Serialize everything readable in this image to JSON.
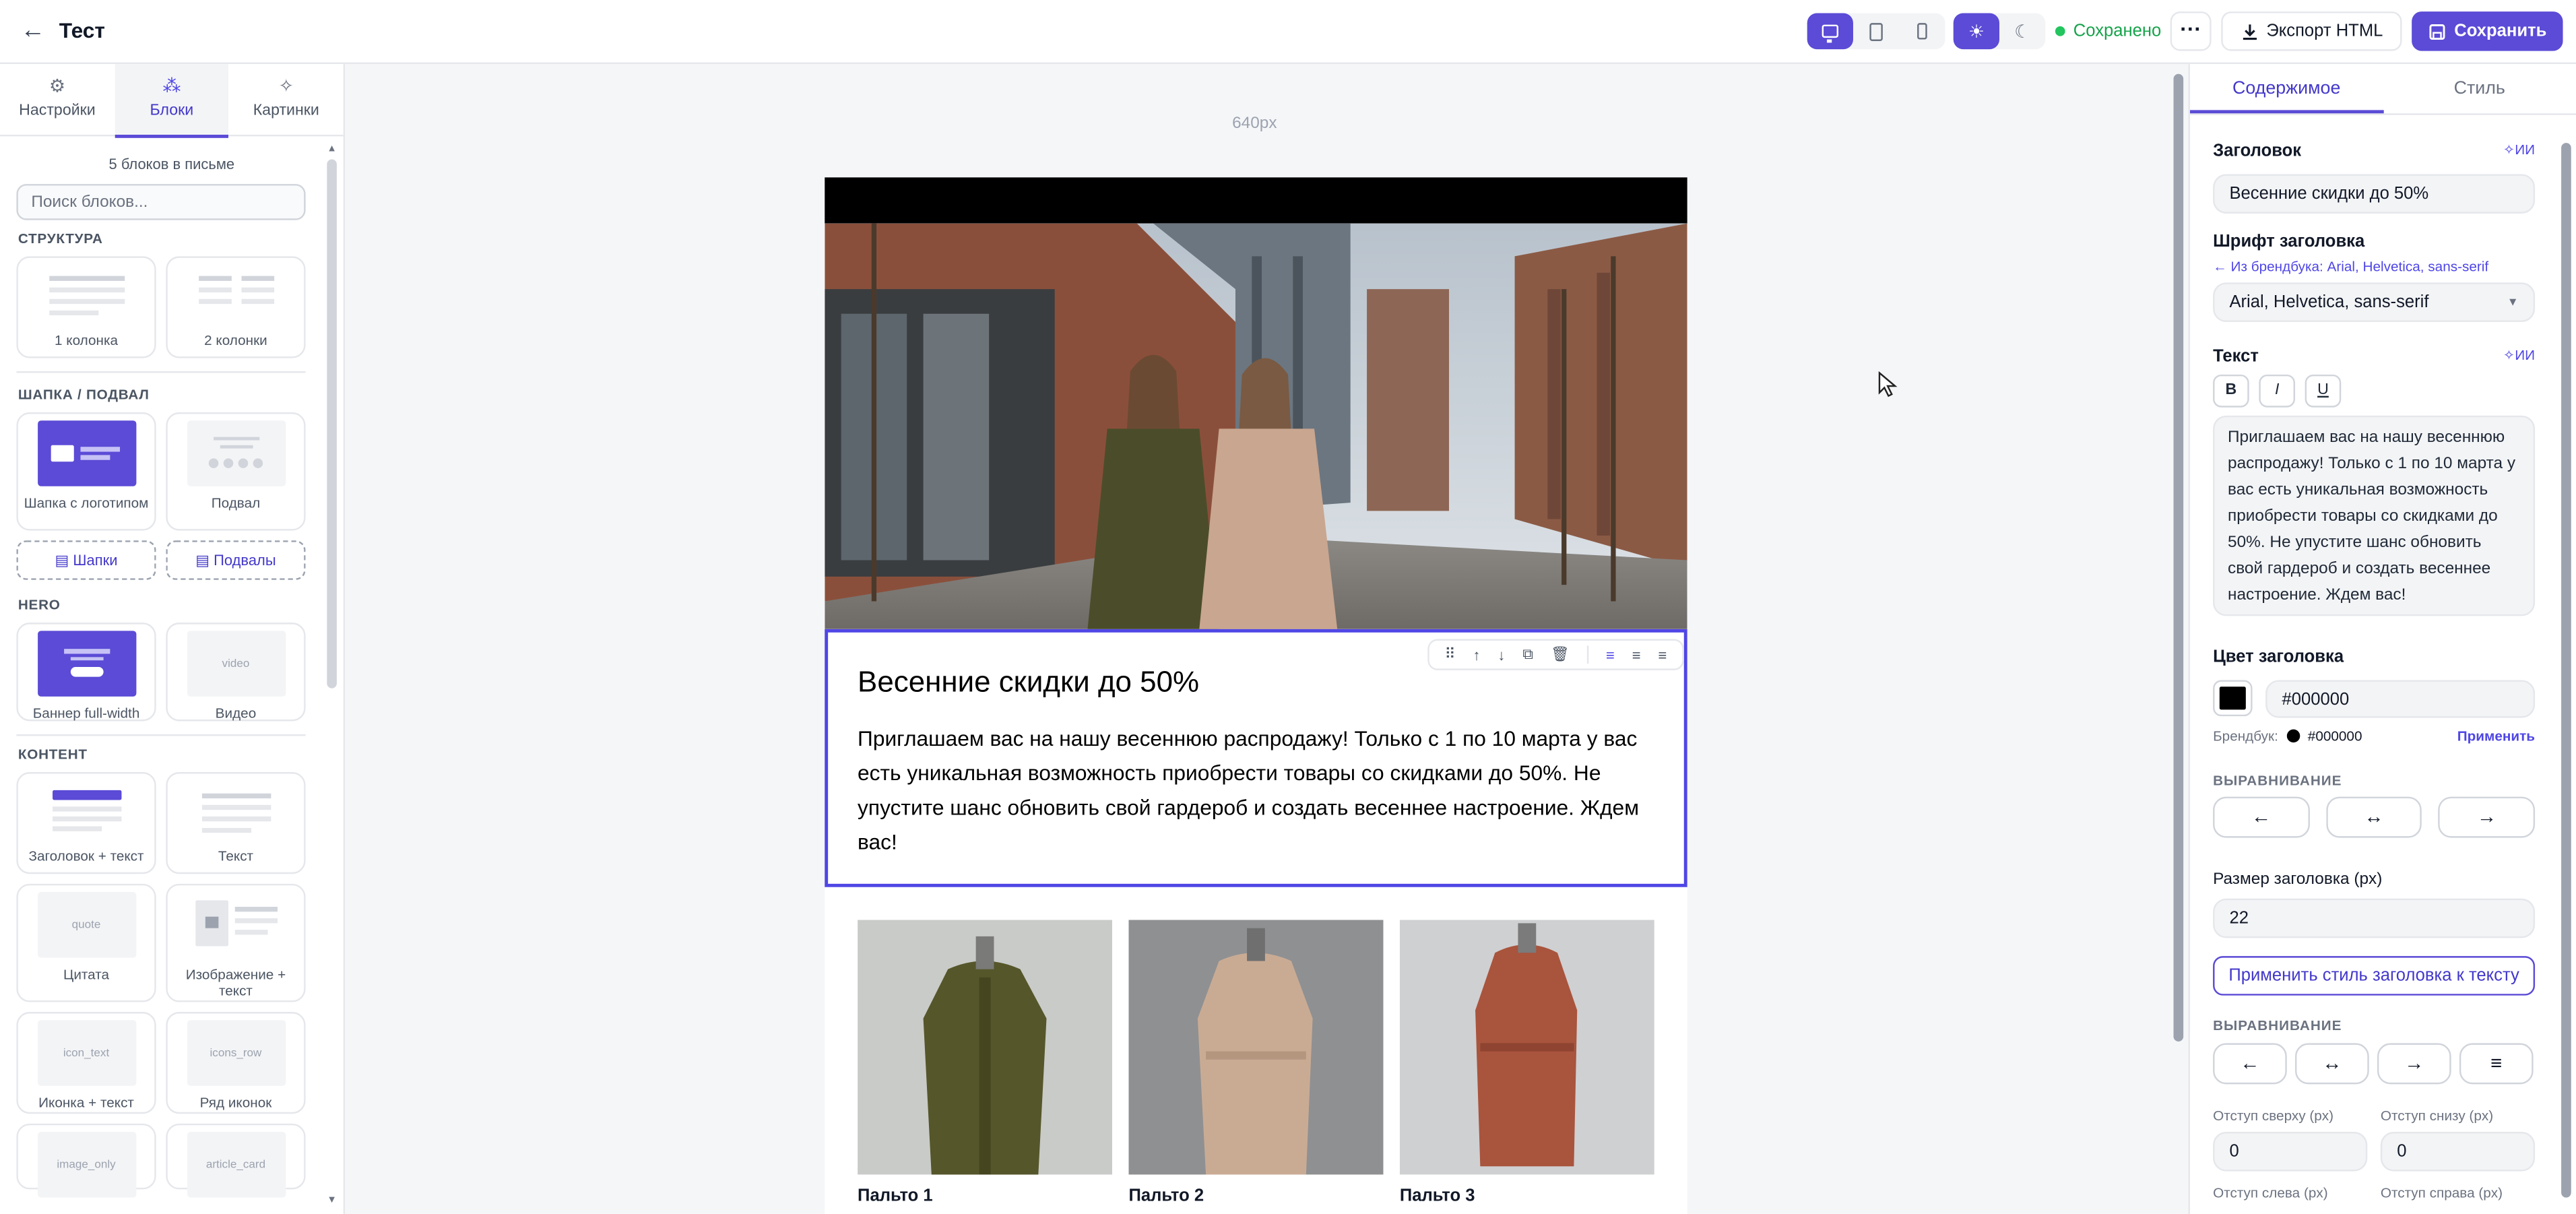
{
  "header": {
    "back_icon": "arrow-left-icon",
    "title": "Тест",
    "saved_status": "Сохранено",
    "export_label": "Экспорт HTML",
    "save_label": "Сохранить",
    "more_icon": "more-dots-icon",
    "accent_color": "#5b4bd6",
    "status_color": "#16a34a"
  },
  "left_panel": {
    "tabs": [
      {
        "label": "Настройки",
        "icon": "gear-icon"
      },
      {
        "label": "Блоки",
        "icon": "blocks-icon"
      },
      {
        "label": "Картинки",
        "icon": "sparkle-icon"
      }
    ],
    "active_tab": "Блоки",
    "block_count": "5 блоков в письме",
    "search_placeholder": "Поиск блоков...",
    "sections": {
      "structure": {
        "title": "СТРУКТУРА",
        "items": [
          "1 колонка",
          "2 колонки"
        ]
      },
      "header_footer": {
        "title": "ШАПКА / ПОДВАЛ",
        "items": [
          "Шапка с логотипом",
          "Подвал"
        ],
        "links": [
          "Шапки",
          "Подвалы"
        ]
      },
      "hero": {
        "title": "HERO",
        "items": [
          "Баннер full-width",
          "Видео"
        ],
        "video_thumb": "video"
      },
      "content": {
        "title": "КОНТЕНТ",
        "items": [
          "Заголовок + текст",
          "Текст",
          "Цитата",
          "Изображение + текст",
          "Иконка + текст",
          "Ряд иконок"
        ],
        "thumbs": {
          "quote": "quote",
          "icon_text": "icon_text",
          "icons_row": "icons_row",
          "image_only": "image_only",
          "article_card": "article_card"
        }
      }
    }
  },
  "canvas": {
    "width_label": "640px",
    "text_block": {
      "heading": "Весенние скидки до 50%",
      "body": "Приглашаем вас на нашу весеннюю распродажу! Только с 1 по 10 марта у вас есть уникальная возможность приобрести товары со скидками до 50%. Не упустите шанс обновить свой гардероб и создать весеннее настроение. Ждем вас!"
    },
    "products": [
      {
        "name": "Пальто 1",
        "color": "#5a5a2c"
      },
      {
        "name": "Пальто 2",
        "color": "#c8a890"
      },
      {
        "name": "Пальто 3",
        "color": "#b45a42"
      }
    ]
  },
  "right_panel": {
    "tabs": [
      "Содержимое",
      "Стиль"
    ],
    "active_tab": "Содержимое",
    "heading_label": "Заголовок",
    "ai_label": "ИИ",
    "heading_value": "Весенние скидки до 50%",
    "heading_font_label": "Шрифт заголовка",
    "brandbook_hint": "← Из брендбука: Arial, Helvetica, sans-serif",
    "heading_font_value": "Arial, Helvetica, sans-serif",
    "text_label": "Текст",
    "format_buttons": [
      "B",
      "I",
      "U"
    ],
    "text_value": "Приглашаем вас на нашу весеннюю распродажу! Только с 1 по 10 марта у вас есть уникальная возможность приобрести товары со скидками до 50%. Не упустите шанс обновить свой гардероб и создать весеннее настроение. Ждем вас!",
    "heading_color_label": "Цвет заголовка",
    "heading_color_value": "#000000",
    "brandbook_color_label": "Брендбук:",
    "brandbook_color_value": "#000000",
    "apply_label": "Применить",
    "alignment_label": "ВЫРАВНИВАНИЕ",
    "align_buttons": [
      "←",
      "↔",
      "→"
    ],
    "heading_size_label": "Размер заголовка (px)",
    "heading_size_value": "22",
    "apply_style_label": "Применить стиль заголовка к тексту",
    "alignment2_label": "ВЫРАВНИВАНИЕ",
    "align2_buttons": [
      "←",
      "↔",
      "→",
      "≡"
    ],
    "padding_top_label": "Отступ сверху (px)",
    "padding_top_value": "0",
    "padding_bottom_label": "Отступ снизу (px)",
    "padding_bottom_value": "0",
    "padding_left_label": "Отступ слева (px)",
    "padding_right_label": "Отступ справа (px)"
  }
}
